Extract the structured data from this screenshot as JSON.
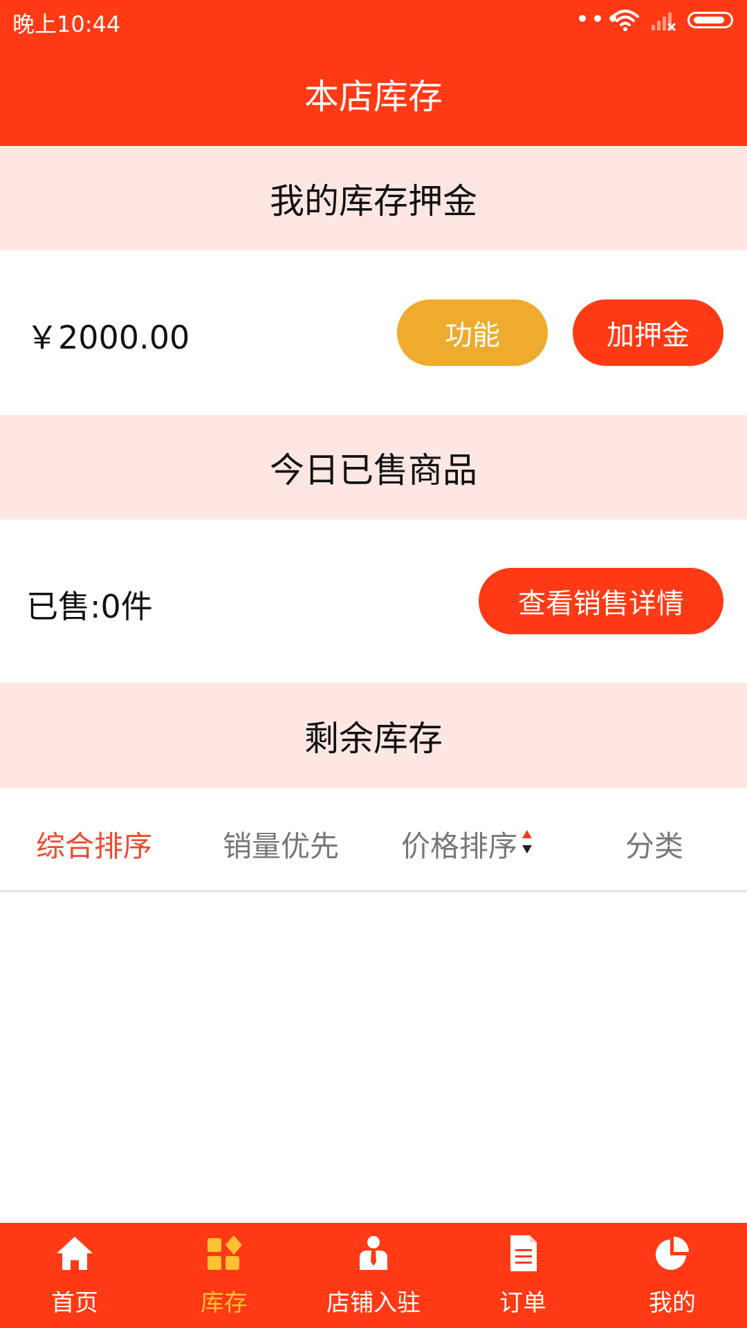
{
  "status_bar": {
    "time": "晚上10:44",
    "dots": "•••"
  },
  "header": {
    "title": "本店库存"
  },
  "deposit": {
    "section_title": "我的库存押金",
    "amount": "￥2000.00",
    "function_button": "功能",
    "add_deposit_button": "加押金"
  },
  "sold_today": {
    "section_title": "今日已售商品",
    "sold_count": "已售:0件",
    "view_details_button": "查看销售详情"
  },
  "remaining": {
    "section_title": "剩余库存",
    "sort_tabs": [
      "综合排序",
      "销量优先",
      "价格排序",
      "分类"
    ],
    "active_tab": "综合排序"
  },
  "bottom_nav": {
    "items": [
      {
        "label": "首页",
        "icon": "home-icon"
      },
      {
        "label": "库存",
        "icon": "inventory-icon"
      },
      {
        "label": "店铺入驻",
        "icon": "merchant-icon"
      },
      {
        "label": "订单",
        "icon": "order-document-icon"
      },
      {
        "label": "我的",
        "icon": "pie-chart-icon"
      }
    ],
    "active_index": 1
  },
  "colors": {
    "primary_red": "#ff3a14",
    "band_pink": "#fee7e3",
    "button_orange": "#efab2d",
    "active_nav": "#ffc234",
    "active_sort": "#ee4a2c"
  }
}
